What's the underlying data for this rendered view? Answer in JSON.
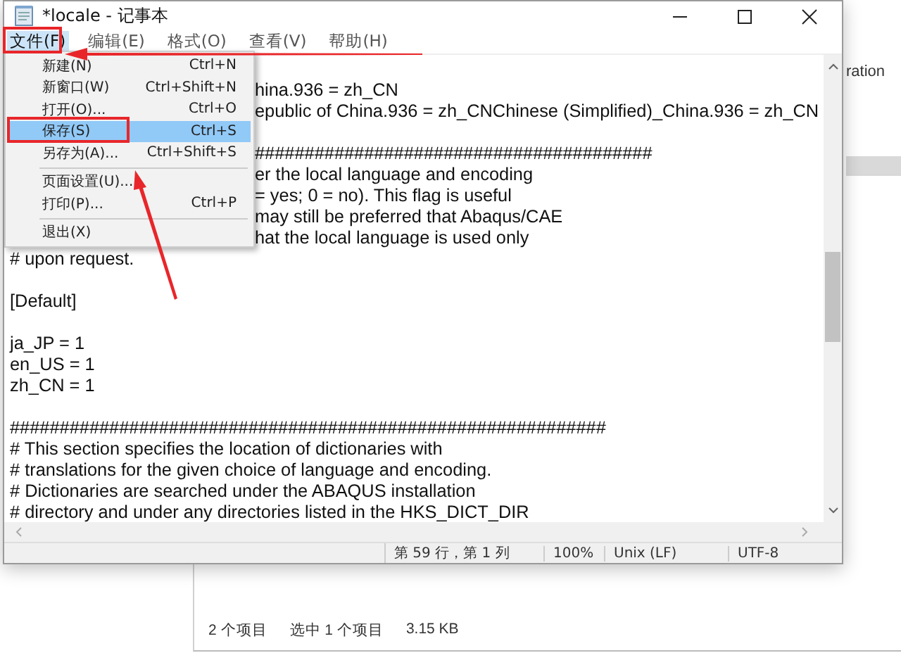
{
  "explorer": {
    "column_header": "ration",
    "status_items": [
      "2 个项目",
      "选中 1 个项目",
      "3.15 KB"
    ]
  },
  "notepad": {
    "title": "*locale - 记事本",
    "menu": [
      {
        "label": "文件(F)",
        "selected": true
      },
      {
        "label": "编辑(E)",
        "selected": false
      },
      {
        "label": "格式(O)",
        "selected": false
      },
      {
        "label": "查看(V)",
        "selected": false
      },
      {
        "label": "帮助(H)",
        "selected": false
      }
    ],
    "file_menu": [
      {
        "kind": "item",
        "label": "新建(N)",
        "shortcut": "Ctrl+N",
        "selected": false
      },
      {
        "kind": "item",
        "label": "新窗口(W)",
        "shortcut": "Ctrl+Shift+N",
        "selected": false
      },
      {
        "kind": "item",
        "label": "打开(O)...",
        "shortcut": "Ctrl+O",
        "selected": false
      },
      {
        "kind": "item",
        "label": "保存(S)",
        "shortcut": "Ctrl+S",
        "selected": true
      },
      {
        "kind": "item",
        "label": "另存为(A)...",
        "shortcut": "Ctrl+Shift+S",
        "selected": false
      },
      {
        "kind": "separator"
      },
      {
        "kind": "item",
        "label": "页面设置(U)...",
        "selected": false
      },
      {
        "kind": "item",
        "label": "打印(P)...",
        "shortcut": "Ctrl+P",
        "selected": false
      },
      {
        "kind": "separator"
      },
      {
        "kind": "item",
        "label": "退出(X)",
        "selected": false
      }
    ],
    "lines": [
      {
        "kind": "blank"
      },
      {
        "kind": "text",
        "text": "hina.936 = zh_CN",
        "covered": true
      },
      {
        "kind": "text",
        "text": "epublic of China.936 = zh_CNChinese (Simplified)_China.936 = zh_CN",
        "covered": true
      },
      {
        "kind": "blank"
      },
      {
        "kind": "text",
        "text": "########################################",
        "covered": true
      },
      {
        "kind": "text",
        "text": "er the local language and encoding",
        "covered": true
      },
      {
        "kind": "text",
        "text": "= yes; 0 = no).  This flag is useful",
        "covered": true
      },
      {
        "kind": "text",
        "text": "may still be preferred that Abaqus/CAE",
        "covered": true
      },
      {
        "kind": "text",
        "text": "hat the local language is used only",
        "covered": true
      },
      {
        "kind": "text",
        "text": "# upon request."
      },
      {
        "kind": "blank"
      },
      {
        "kind": "text",
        "text": "[Default]"
      },
      {
        "kind": "blank"
      },
      {
        "kind": "text",
        "text": "ja_JP = 1"
      },
      {
        "kind": "text",
        "text": "en_US = 1"
      },
      {
        "kind": "text",
        "text": "zh_CN = 1"
      },
      {
        "kind": "blank"
      },
      {
        "kind": "text",
        "text": "############################################################"
      },
      {
        "kind": "text",
        "text": "# This section specifies the location of dictionaries with"
      },
      {
        "kind": "text",
        "text": "# translations for the given choice of language and encoding."
      },
      {
        "kind": "text",
        "text": "# Dictionaries are searched under the ABAQUS installation"
      },
      {
        "kind": "text",
        "text": "# directory and under any directories listed in the HKS_DICT_DIR"
      }
    ],
    "status": [
      "第 59 行，第 1 列",
      "100%",
      "Unix (LF)",
      "UTF-8"
    ]
  }
}
